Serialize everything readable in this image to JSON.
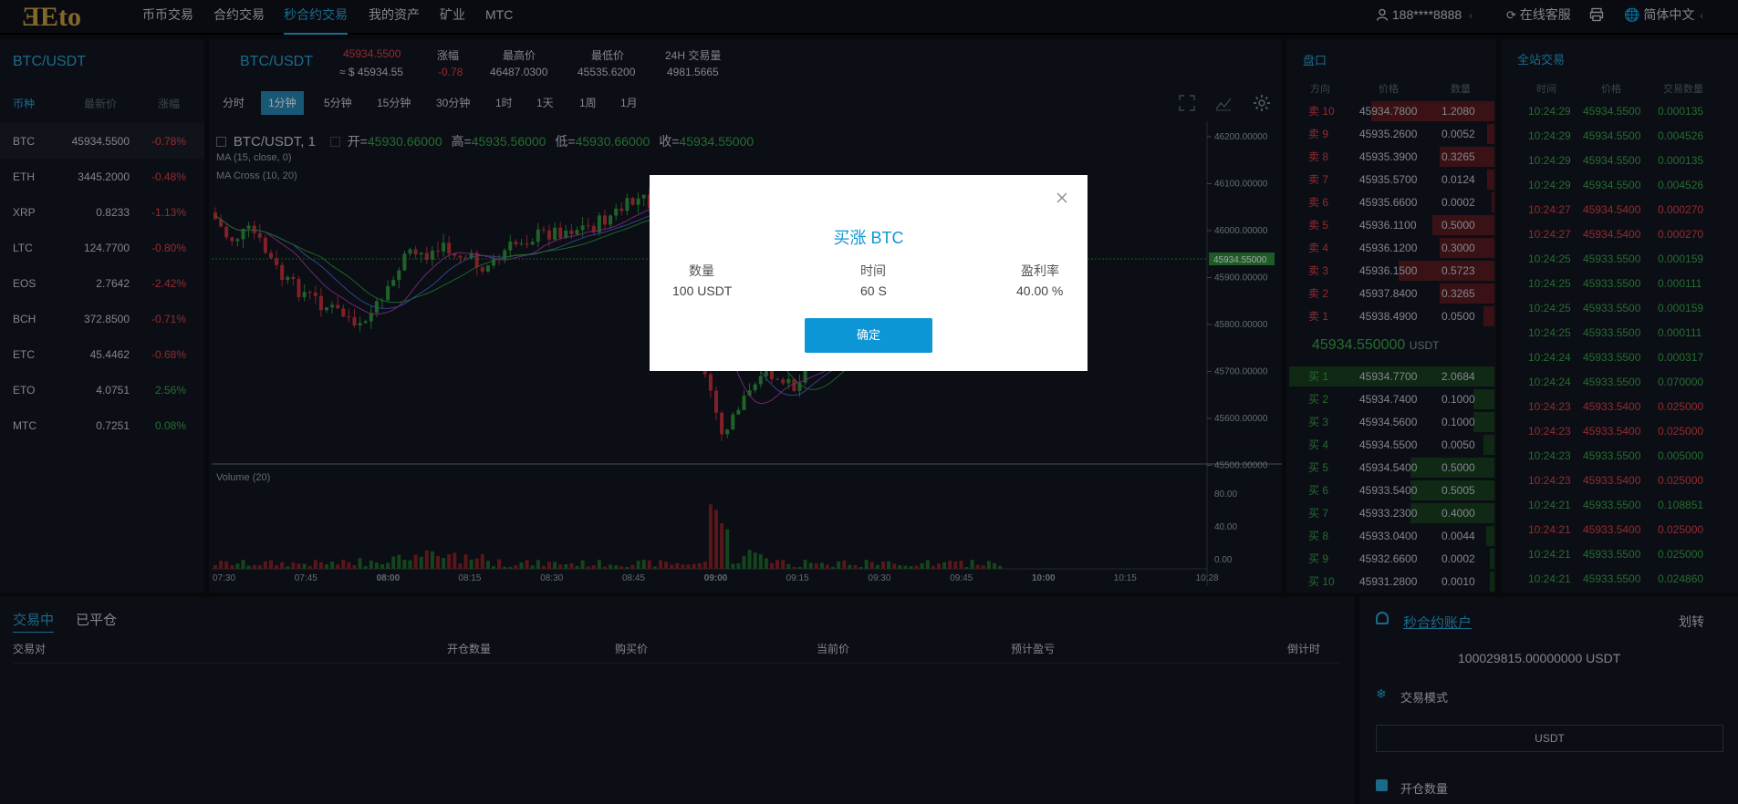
{
  "nav": {
    "logo": "ƎEto",
    "items": [
      "币币交易",
      "合约交易",
      "秒合约交易",
      "我的资产",
      "矿业",
      "MTC"
    ],
    "user": "188****8888",
    "service": "在线客服",
    "language": "简体中文"
  },
  "market": {
    "title": "BTC/USDT",
    "headers": [
      "币种",
      "最新价",
      "涨幅"
    ],
    "rows": [
      {
        "coin": "BTC",
        "price": "45934.5500",
        "change": "-0.78%",
        "dir": "down"
      },
      {
        "coin": "ETH",
        "price": "3445.2000",
        "change": "-0.48%",
        "dir": "down"
      },
      {
        "coin": "XRP",
        "price": "0.8233",
        "change": "-1.13%",
        "dir": "down"
      },
      {
        "coin": "LTC",
        "price": "124.7700",
        "change": "-0.80%",
        "dir": "down"
      },
      {
        "coin": "EOS",
        "price": "2.7642",
        "change": "-2.42%",
        "dir": "down"
      },
      {
        "coin": "BCH",
        "price": "372.8500",
        "change": "-0.71%",
        "dir": "down"
      },
      {
        "coin": "ETC",
        "price": "45.4462",
        "change": "-0.68%",
        "dir": "down"
      },
      {
        "coin": "ETO",
        "price": "4.0751",
        "change": "2.56%",
        "dir": "up"
      },
      {
        "coin": "MTC",
        "price": "0.7251",
        "change": "0.08%",
        "dir": "up"
      }
    ]
  },
  "ticker": {
    "pair": "BTC/USDT",
    "price": "45934.5500",
    "price_usd": "≈ $ 45934.55",
    "change_label": "涨幅",
    "change": "-0.78",
    "high_label": "最高价",
    "high": "46487.0300",
    "low_label": "最低价",
    "low": "45535.6200",
    "vol_label": "24H 交易量",
    "vol": "4981.5665"
  },
  "chart": {
    "timeframes": [
      "分时",
      "1分钟",
      "5分钟",
      "15分钟",
      "30分钟",
      "1时",
      "1天",
      "1周",
      "1月"
    ],
    "active_tf": "1分钟",
    "legend_symbol": "BTC/USDT, 1",
    "legend_open_label": "开=",
    "legend_open": "45930.66000",
    "legend_high_label": "高=",
    "legend_high": "45935.56000",
    "legend_low_label": "低=",
    "legend_low": "45930.66000",
    "legend_close_label": "收=",
    "legend_close": "45934.55000",
    "ma_label": "MA (15, close, 0)",
    "macross_label": "MA Cross (10, 20)",
    "volume_label": "Volume (20)",
    "price_ticks": [
      "46200.00000",
      "46100.00000",
      "46000.00000",
      "45900.00000",
      "45800.00000",
      "45700.00000",
      "45600.00000",
      "45500.00000"
    ],
    "current_price_tag": "45934.55000",
    "vol_ticks": [
      "80.00",
      "40.00",
      "0.00"
    ],
    "time_ticks": [
      "07:30",
      "07:45",
      "08:00",
      "08:15",
      "08:30",
      "08:45",
      "09:00",
      "09:15",
      "09:30",
      "09:45",
      "10:00",
      "10:15",
      "10:28"
    ]
  },
  "orderbook": {
    "title": "盘口",
    "headers": [
      "方向",
      "价格",
      "数量"
    ],
    "asks": [
      {
        "side": "卖 10",
        "price": "45934.7800",
        "qty": "1.2080",
        "depth": 0.9
      },
      {
        "side": "卖 9",
        "price": "45935.2600",
        "qty": "0.0052",
        "depth": 0.05
      },
      {
        "side": "卖 8",
        "price": "45935.3900",
        "qty": "0.3265",
        "depth": 0.4
      },
      {
        "side": "卖 7",
        "price": "45935.5700",
        "qty": "0.0124",
        "depth": 0.05
      },
      {
        "side": "卖 6",
        "price": "45935.6600",
        "qty": "0.0002",
        "depth": 0.02
      },
      {
        "side": "卖 5",
        "price": "45936.1100",
        "qty": "0.5000",
        "depth": 0.45
      },
      {
        "side": "卖 4",
        "price": "45936.1200",
        "qty": "0.3000",
        "depth": 0.4
      },
      {
        "side": "卖 3",
        "price": "45936.1500",
        "qty": "0.5723",
        "depth": 0.7
      },
      {
        "side": "卖 2",
        "price": "45937.8400",
        "qty": "0.3265",
        "depth": 0.4
      },
      {
        "side": "卖 1",
        "price": "45938.4900",
        "qty": "0.0500",
        "depth": 0.08
      }
    ],
    "mid_price": "45934.550000",
    "mid_unit": "USDT",
    "bids": [
      {
        "side": "买 1",
        "price": "45934.7700",
        "qty": "2.0684",
        "depth": 0.98
      },
      {
        "side": "买 2",
        "price": "45934.7400",
        "qty": "0.1000",
        "depth": 0.1
      },
      {
        "side": "买 3",
        "price": "45934.5600",
        "qty": "0.1000",
        "depth": 0.1
      },
      {
        "side": "买 4",
        "price": "45934.5500",
        "qty": "0.0050",
        "depth": 0.05
      },
      {
        "side": "买 5",
        "price": "45934.5400",
        "qty": "0.5000",
        "depth": 0.4
      },
      {
        "side": "买 6",
        "price": "45933.5400",
        "qty": "0.5005",
        "depth": 0.4
      },
      {
        "side": "买 7",
        "price": "45933.2300",
        "qty": "0.4000",
        "depth": 0.4
      },
      {
        "side": "买 8",
        "price": "45933.0400",
        "qty": "0.0044",
        "depth": 0.04
      },
      {
        "side": "买 9",
        "price": "45932.6600",
        "qty": "0.0002",
        "depth": 0.02
      },
      {
        "side": "买 10",
        "price": "45931.2800",
        "qty": "0.0010",
        "depth": 0.02
      }
    ]
  },
  "trades": {
    "title": "全站交易",
    "headers": [
      "时间",
      "价格",
      "交易数量"
    ],
    "rows": [
      {
        "time": "10:24:29",
        "price": "45934.5500",
        "qty": "0.000135",
        "dir": "up"
      },
      {
        "time": "10:24:29",
        "price": "45934.5500",
        "qty": "0.004526",
        "dir": "up"
      },
      {
        "time": "10:24:29",
        "price": "45934.5500",
        "qty": "0.000135",
        "dir": "up"
      },
      {
        "time": "10:24:29",
        "price": "45934.5500",
        "qty": "0.004526",
        "dir": "up"
      },
      {
        "time": "10:24:27",
        "price": "45934.5400",
        "qty": "0.000270",
        "dir": "down"
      },
      {
        "time": "10:24:27",
        "price": "45934.5400",
        "qty": "0.000270",
        "dir": "down"
      },
      {
        "time": "10:24:25",
        "price": "45933.5500",
        "qty": "0.000159",
        "dir": "up"
      },
      {
        "time": "10:24:25",
        "price": "45933.5500",
        "qty": "0.000111",
        "dir": "up"
      },
      {
        "time": "10:24:25",
        "price": "45933.5500",
        "qty": "0.000159",
        "dir": "up"
      },
      {
        "time": "10:24:25",
        "price": "45933.5500",
        "qty": "0.000111",
        "dir": "up"
      },
      {
        "time": "10:24:24",
        "price": "45933.5500",
        "qty": "0.000317",
        "dir": "up"
      },
      {
        "time": "10:24:24",
        "price": "45933.5500",
        "qty": "0.070000",
        "dir": "up"
      },
      {
        "time": "10:24:23",
        "price": "45933.5400",
        "qty": "0.025000",
        "dir": "down"
      },
      {
        "time": "10:24:23",
        "price": "45933.5400",
        "qty": "0.025000",
        "dir": "down"
      },
      {
        "time": "10:24:23",
        "price": "45933.5500",
        "qty": "0.005000",
        "dir": "up"
      },
      {
        "time": "10:24:23",
        "price": "45933.5400",
        "qty": "0.025000",
        "dir": "down"
      },
      {
        "time": "10:24:21",
        "price": "45933.5500",
        "qty": "0.108851",
        "dir": "up"
      },
      {
        "time": "10:24:21",
        "price": "45933.5400",
        "qty": "0.025000",
        "dir": "down"
      },
      {
        "time": "10:24:21",
        "price": "45933.5500",
        "qty": "0.025000",
        "dir": "up"
      },
      {
        "time": "10:24:21",
        "price": "45933.5500",
        "qty": "0.024860",
        "dir": "up"
      }
    ]
  },
  "orders": {
    "tabs": [
      "交易中",
      "已平仓"
    ],
    "columns": [
      "交易对",
      "开仓数量",
      "购买价",
      "当前价",
      "预计盈亏",
      "倒计时"
    ]
  },
  "account": {
    "title": "秒合约账户",
    "transfer": "划转",
    "balance": "100029815.00000000 USDT",
    "mode_label": "交易模式",
    "mode_value": "USDT",
    "qty_label": "开仓数量"
  },
  "modal": {
    "title": "买涨 BTC",
    "qty_label": "数量",
    "qty_value": "100 USDT",
    "time_label": "时间",
    "time_value": "60 S",
    "rate_label": "盈利率",
    "rate_value": "40.00 %",
    "confirm": "确定"
  }
}
